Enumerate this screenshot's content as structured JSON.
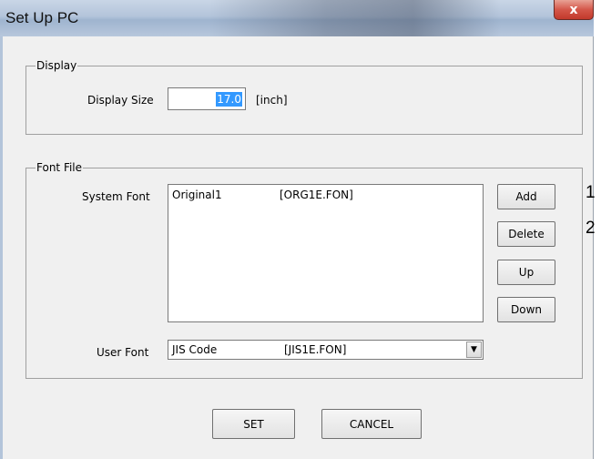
{
  "window": {
    "title": "Set Up PC",
    "close_label": "x"
  },
  "display_group": {
    "legend": "Display",
    "size_label": "Display Size",
    "size_value": "17.0",
    "unit": "[inch]"
  },
  "font_group": {
    "legend": "Font File",
    "system_font_label": "System Font",
    "system_fonts": [
      {
        "name": "Original1",
        "file": "[ORG1E.FON]"
      }
    ],
    "buttons": {
      "add": "Add",
      "delete": "Delete",
      "up": "Up",
      "down": "Down"
    },
    "user_font_label": "User Font",
    "user_font_selected": {
      "name": "JIS Code",
      "file": "[JIS1E.FON]"
    }
  },
  "footer": {
    "set": "SET",
    "cancel": "CANCEL"
  },
  "callouts": [
    "1",
    "2"
  ]
}
